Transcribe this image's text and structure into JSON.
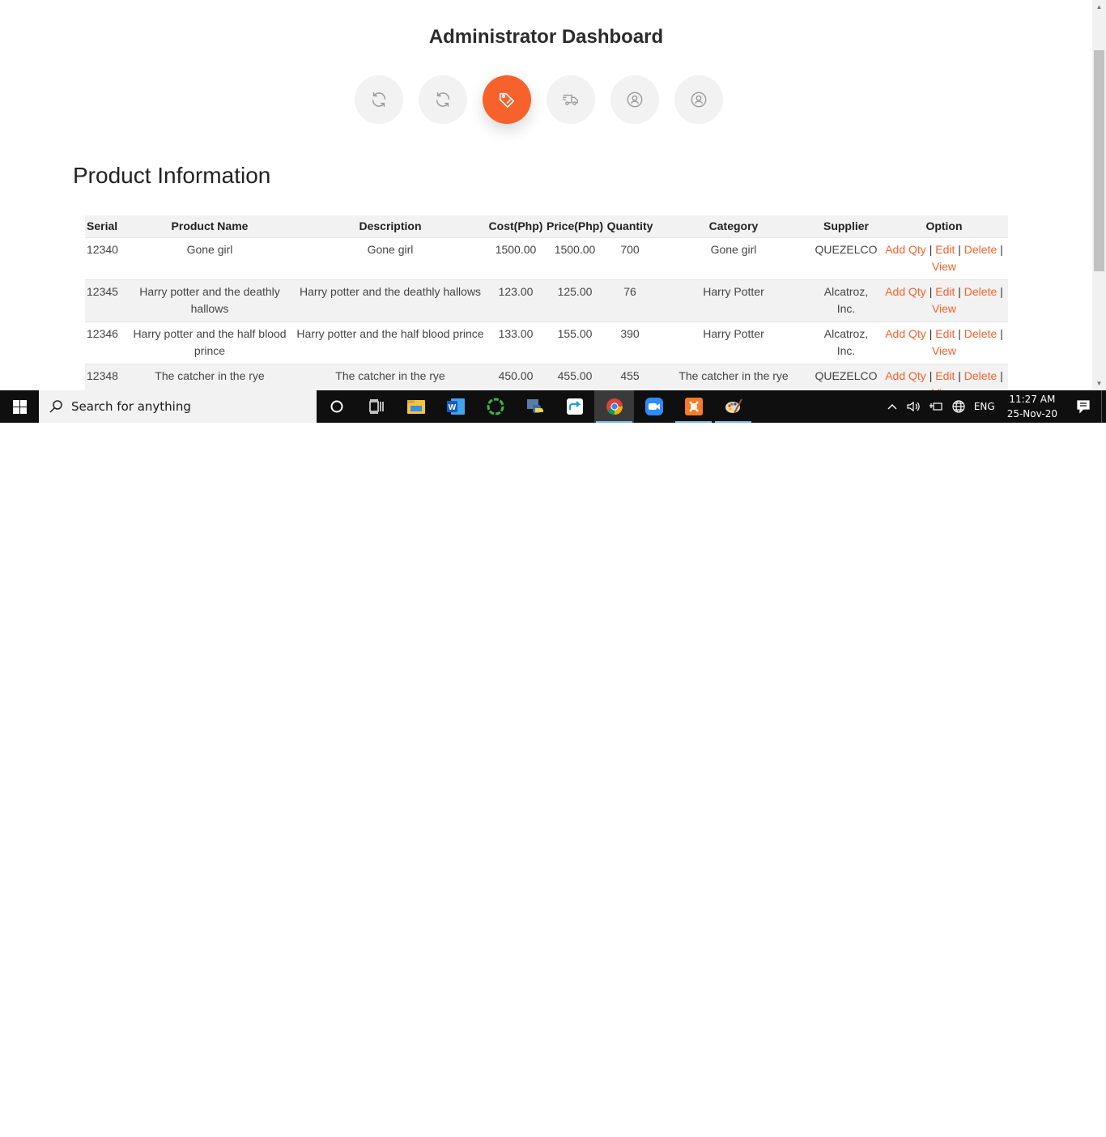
{
  "page": {
    "title": "Administrator Dashboard",
    "section_title": "Product Information"
  },
  "nav_buttons": [
    {
      "icon": "refresh-icon",
      "active": false
    },
    {
      "icon": "refresh-icon",
      "active": false
    },
    {
      "icon": "tag-icon",
      "active": true
    },
    {
      "icon": "delivery-truck-icon",
      "active": false
    },
    {
      "icon": "user-circle-icon",
      "active": false
    },
    {
      "icon": "user-circle-icon",
      "active": false
    }
  ],
  "table": {
    "headers": [
      "Serial",
      "Product Name",
      "Description",
      "Cost(Php)",
      "Price(Php)",
      "Quantity",
      "Category",
      "Supplier",
      "Option"
    ],
    "rows": [
      {
        "serial": "12340",
        "name": "Gone girl",
        "description": "Gone girl",
        "cost": "1500.00",
        "price": "1500.00",
        "quantity": "700",
        "category": "Gone girl",
        "supplier": "QUEZELCO"
      },
      {
        "serial": "12345",
        "name": "Harry potter and the deathly hallows",
        "description": "Harry potter and the deathly hallows",
        "cost": "123.00",
        "price": "125.00",
        "quantity": "76",
        "category": "Harry Potter",
        "supplier": "Alcatroz, Inc."
      },
      {
        "serial": "12346",
        "name": "Harry potter and the half blood prince",
        "description": "Harry potter and the half blood prince",
        "cost": "133.00",
        "price": "155.00",
        "quantity": "390",
        "category": "Harry Potter",
        "supplier": "Alcatroz, Inc."
      },
      {
        "serial": "12348",
        "name": "The catcher in the rye",
        "description": "The catcher in the rye",
        "cost": "450.00",
        "price": "455.00",
        "quantity": "455",
        "category": "The catcher in the rye",
        "supplier": "QUEZELCO"
      }
    ],
    "options": {
      "add_qty": "Add Qty",
      "edit": "Edit",
      "delete": "Delete",
      "view": "View",
      "separator": "|"
    }
  },
  "colors": {
    "accent": "#f7622c",
    "taskbar": "#0f0f0f"
  },
  "taskbar": {
    "search_placeholder": "Search for anything",
    "apps": [
      "cortana-icon",
      "task-view-icon",
      "file-explorer-icon",
      "word-icon",
      "app-green-circle-icon",
      "python-icon",
      "send-arrow-icon",
      "chrome-icon",
      "zoom-icon",
      "xampp-icon",
      "paint-icon"
    ],
    "language": "ENG",
    "time": "11:27 AM",
    "date": "25-Nov-20"
  }
}
